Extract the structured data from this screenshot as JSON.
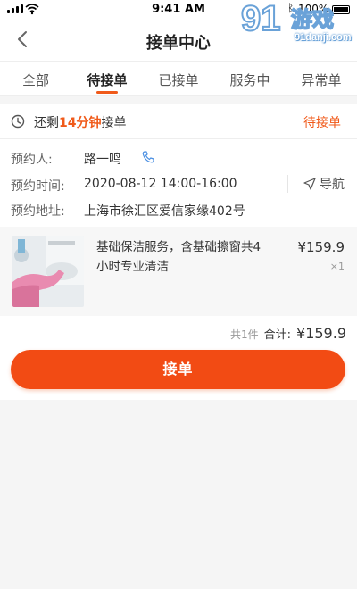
{
  "status_bar": {
    "time": "9:41 AM",
    "battery": "100%"
  },
  "header": {
    "title": "接单中心",
    "watermark_text": "91danji.com"
  },
  "tabs": [
    {
      "label": "全部"
    },
    {
      "label": "待接单",
      "active": true
    },
    {
      "label": "已接单"
    },
    {
      "label": "服务中"
    },
    {
      "label": "异常单"
    }
  ],
  "order": {
    "countdown_prefix": "还剩",
    "countdown_value": "14分钟",
    "countdown_suffix": "接单",
    "status": "待接单",
    "customer_label": "预约人:",
    "customer_name": "路一鸣",
    "time_label": "预约时间:",
    "time_value": "2020-08-12 14:00-16:00",
    "address_label": "预约地址:",
    "address_value": "上海市徐汇区爱信家缘402号",
    "navigate_label": "导航",
    "product": {
      "name": "基础保洁服务，含基础擦窗共4小时专业清洁",
      "price": "¥159.9",
      "qty": "×1"
    },
    "item_count": "共1件",
    "total_label": "合计:",
    "total_value": "¥159.9",
    "accept_label": "接单"
  },
  "colors": {
    "accent": "#f05a1a",
    "button": "#f24b14"
  }
}
